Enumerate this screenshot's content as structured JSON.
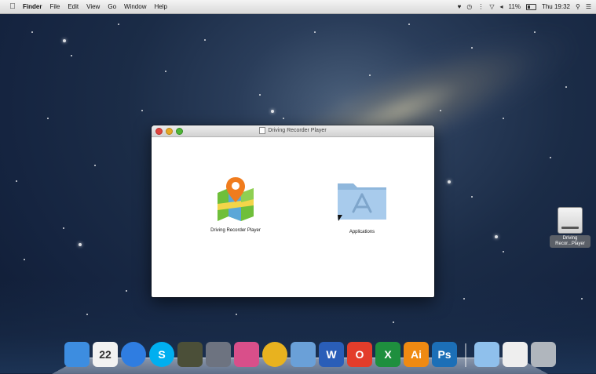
{
  "menubar": {
    "apple_icon": "apple-icon",
    "items": [
      "Finder",
      "File",
      "Edit",
      "View",
      "Go",
      "Window",
      "Help"
    ],
    "battery_percent": "11%",
    "clock": "Thu 19:32"
  },
  "window": {
    "title": "Driving Recorder Player",
    "items": [
      {
        "label": "Driving Recorder Player",
        "icon": "map-app-icon"
      },
      {
        "label": "Applications",
        "icon": "applications-folder-icon"
      }
    ]
  },
  "desktop": {
    "drive_label_line1": "Driving",
    "drive_label_line2": "Recor...Player"
  },
  "dock": {
    "apps": [
      {
        "name": "finder",
        "color": "#3d8de0"
      },
      {
        "name": "calendar",
        "text": "22",
        "color": "#f2f2f2"
      },
      {
        "name": "app-store",
        "color": "#2f7de1"
      },
      {
        "name": "skype",
        "text": "S",
        "color": "#00aff0"
      },
      {
        "name": "game",
        "color": "#4b4f38"
      },
      {
        "name": "controller",
        "color": "#6d7380"
      },
      {
        "name": "heart-app",
        "color": "#d94f8a"
      },
      {
        "name": "chrome",
        "color": "#e8b21f"
      },
      {
        "name": "preview",
        "color": "#6aa0d8"
      },
      {
        "name": "word",
        "text": "W",
        "color": "#2a5eb8"
      },
      {
        "name": "opera",
        "text": "O",
        "color": "#e33d2b"
      },
      {
        "name": "excel",
        "text": "X",
        "color": "#1e8f3e"
      },
      {
        "name": "illustrator",
        "text": "Ai",
        "color": "#ef8a12"
      },
      {
        "name": "photoshop",
        "text": "Ps",
        "color": "#1c6fb7"
      }
    ],
    "stack_items": [
      {
        "name": "documents-folder",
        "color": "#8fc0ec"
      },
      {
        "name": "document",
        "color": "#eeeeee"
      },
      {
        "name": "trash",
        "color": "#b0b6bd"
      }
    ]
  }
}
